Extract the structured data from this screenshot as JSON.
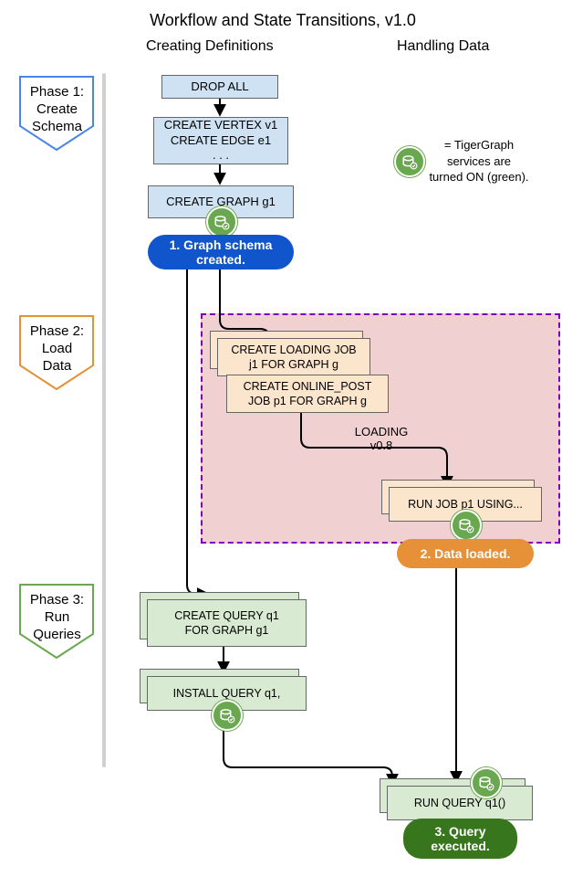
{
  "title": "Workflow and State Transitions, v1.0",
  "columns": {
    "definitions": "Creating Definitions",
    "data": "Handling Data"
  },
  "phases": {
    "p1": "Phase 1:\nCreate\nSchema",
    "p2": "Phase 2:\nLoad\nData",
    "p3": "Phase 3:\nRun\nQueries"
  },
  "legend": {
    "text": "= TigerGraph services are turned ON (green)."
  },
  "schema": {
    "drop_all": "DROP ALL",
    "create_vertex_edge": "CREATE VERTEX v1\nCREATE EDGE e1\n. . .",
    "create_graph": "CREATE GRAPH g1",
    "state": "1. Graph schema created."
  },
  "load": {
    "create_loading_job": "CREATE LOADING JOB\nj1 FOR GRAPH g",
    "create_online_post": "CREATE ONLINE_POST\nJOB p1 FOR GRAPH g",
    "loading_label": "LOADING\nv0.8",
    "run_job": "RUN JOB p1 USING...",
    "state": "2. Data loaded."
  },
  "query": {
    "create_query": "CREATE QUERY q1\nFOR GRAPH g1",
    "install_query": "INSTALL QUERY q1,",
    "run_query": "RUN QUERY q1()",
    "state": "3. Query\nexecuted."
  },
  "colors": {
    "phase1": "#4a86e8",
    "phase2": "#e69138",
    "phase3": "#6aa84f",
    "region_fill": "#f0d0d0",
    "region_border": "#8000c0"
  }
}
